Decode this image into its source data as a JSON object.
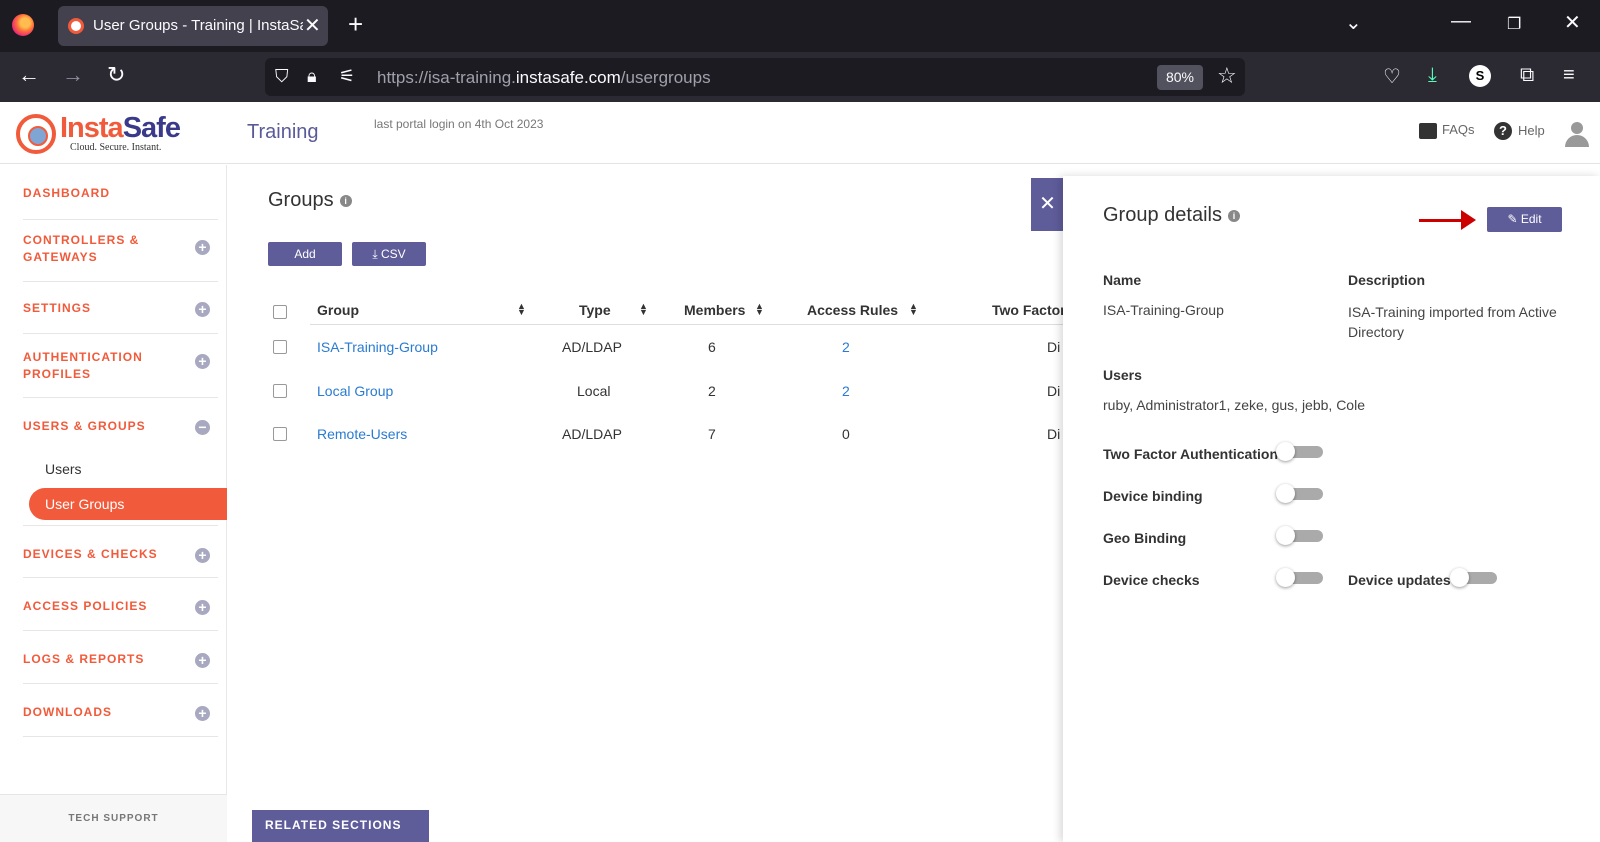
{
  "browser": {
    "tab_title": "User Groups - Training | InstaSafe",
    "url_host_prefix": "https://isa-training.",
    "url_domain": "instasafe.com",
    "url_path": "/usergroups",
    "zoom": "80%",
    "profile_initial": "S"
  },
  "header": {
    "logo_insta": "Insta",
    "logo_safe": "Safe",
    "logo_tagline": "Cloud. Secure. Instant.",
    "portal_name": "Training",
    "last_login": "last portal login on 4th Oct 2023",
    "faqs": "FAQs",
    "help": "Help"
  },
  "sidebar": {
    "items": [
      {
        "label": "DASHBOARD"
      },
      {
        "label": "CONTROLLERS & GATEWAYS"
      },
      {
        "label": "SETTINGS"
      },
      {
        "label": "AUTHENTICATION PROFILES"
      },
      {
        "label": "USERS & GROUPS"
      },
      {
        "label": "DEVICES & CHECKS"
      },
      {
        "label": "ACCESS POLICIES"
      },
      {
        "label": "LOGS & REPORTS"
      },
      {
        "label": "DOWNLOADS"
      }
    ],
    "sub_users": "Users",
    "sub_user_groups": "User Groups",
    "tech_support": "TECH SUPPORT"
  },
  "main": {
    "title": "Groups",
    "add_label": "Add",
    "csv_label": "CSV",
    "columns": [
      "Group",
      "Type",
      "Members",
      "Access Rules",
      "Two Factor"
    ],
    "rows": [
      {
        "group": "ISA-Training-Group",
        "type": "AD/LDAP",
        "members": "6",
        "rules": "2",
        "two_factor": "Di"
      },
      {
        "group": "Local Group",
        "type": "Local",
        "members": "2",
        "rules": "2",
        "two_factor": "Di"
      },
      {
        "group": "Remote-Users",
        "type": "AD/LDAP",
        "members": "7",
        "rules": "0",
        "two_factor": "Di"
      }
    ],
    "related": "RELATED SECTIONS"
  },
  "details": {
    "title": "Group details",
    "edit_label": "Edit",
    "name_label": "Name",
    "name_value": "ISA-Training-Group",
    "desc_label": "Description",
    "desc_value": "ISA-Training imported from Active Directory",
    "users_label": "Users",
    "users_value": "ruby, Administrator1, zeke, gus, jebb, Cole",
    "two_factor_label": "Two Factor Authentication",
    "device_binding_label": "Device binding",
    "geo_binding_label": "Geo Binding",
    "device_checks_label": "Device checks",
    "device_updates_label": "Device updates"
  },
  "colors": {
    "accent": "#f15a3a",
    "primary": "#5f5c9a",
    "link": "#2a7bd1"
  }
}
